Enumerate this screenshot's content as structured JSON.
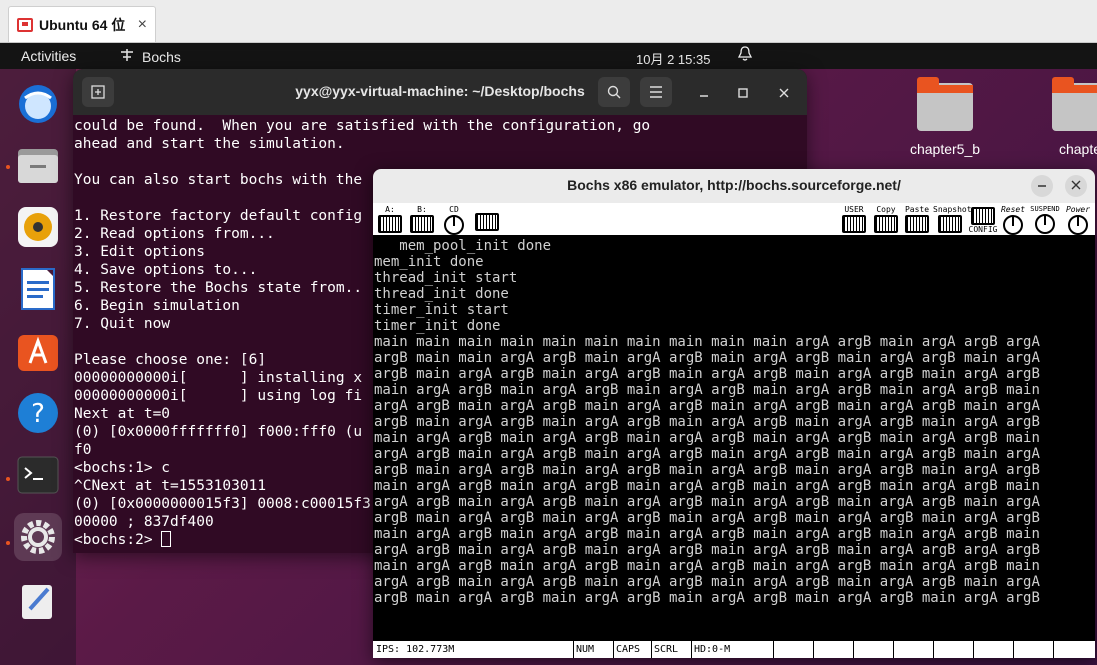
{
  "vm_tab": {
    "title": "Ubuntu 64 位",
    "close": "×"
  },
  "topbar": {
    "activities": "Activities",
    "app_name": "Bochs",
    "clock": "10月 2  15:35"
  },
  "desktop_folders": [
    "chapter5_b",
    "chapte"
  ],
  "terminal": {
    "title": "yyx@yyx-virtual-machine: ~/Desktop/bochs",
    "lines": [
      "could be found.  When you are satisfied with the configuration, go",
      "ahead and start the simulation.",
      "",
      "You can also start bochs with the",
      "",
      "1. Restore factory default config",
      "2. Read options from...",
      "3. Edit options",
      "4. Save options to...",
      "5. Restore the Bochs state from..",
      "6. Begin simulation",
      "7. Quit now",
      "",
      "Please choose one: [6]",
      "00000000000i[      ] installing x",
      "00000000000i[      ] using log fi",
      "Next at t=0",
      "(0) [0x0000fffffff0] f000:fff0 (u",
      "f0",
      "<bochs:1> c",
      "^CNext at t=1553103011",
      "(0) [0x0000000015f3] 0008:c00015f3",
      "00000 ; 837df400"
    ],
    "prompt": "<bochs:2> "
  },
  "bochs": {
    "title": "Bochs x86 emulator, http://bochs.sourceforge.net/",
    "toolbar": {
      "floppy_a": "A:",
      "floppy_b": "B:",
      "cdrom": "CD",
      "user": "USER",
      "copy": "Copy",
      "paste": "Paste",
      "snapshot": "Snapshot",
      "config": "CONFIG",
      "reset": "Reset",
      "suspend": "SUSPEND",
      "power": "Power"
    },
    "screen_lines": [
      "   mem_pool_init done",
      "mem_init done",
      "thread_init start",
      "thread_init done",
      "timer_init start",
      "timer_init done",
      "main main main main main main main main main main argA argB main argA argB argA",
      "argB main main argA argB main argA argB main argA argB main argA argB main argA",
      "argB main argA argB main argA argB main argA argB main argA argB main argA argB",
      "main argA argB main argA argB main argA argB main argA argB main argA argB main",
      "argA argB main argA argB main argA argB main argA argB main argA argB main argA",
      "argB main argA argB main argA argB main argA argB main argA argB main argA argB",
      "main argA argB main argA argB main argA argB main argA argB main argA argB main",
      "argA argB main argA argB main argA argB main argA argB main argA argB main argA",
      "argB main argA argB main argA argB main argA argB main argA argB main argA argB",
      "main argA argB main argA argB main argA argB main argA argB main argA argB main",
      "argA argB main argA argB main argA argB main argA argB main argA argB main argA",
      "argB main argA argB main argA argB main argA argB main argA argB main argA argB",
      "main argA argB main argA argB main argA argB main argA argB main argA argB main",
      "argA argB main argA argB main argA argB main argA argB main argA argB argA argB",
      "main argA argB main argA argB main argA argB main argA argB main argA argB main",
      "argA argB main argA argB main argA argB main argA argB main argA argB main argA",
      "argB main argA argB main argA argB main argA argB main argA argB main argA argB"
    ],
    "status": {
      "ips": "IPS: 102.773M",
      "num": "NUM",
      "caps": "CAPS",
      "scrl": "SCRL",
      "hd": "HD:0-M"
    }
  }
}
